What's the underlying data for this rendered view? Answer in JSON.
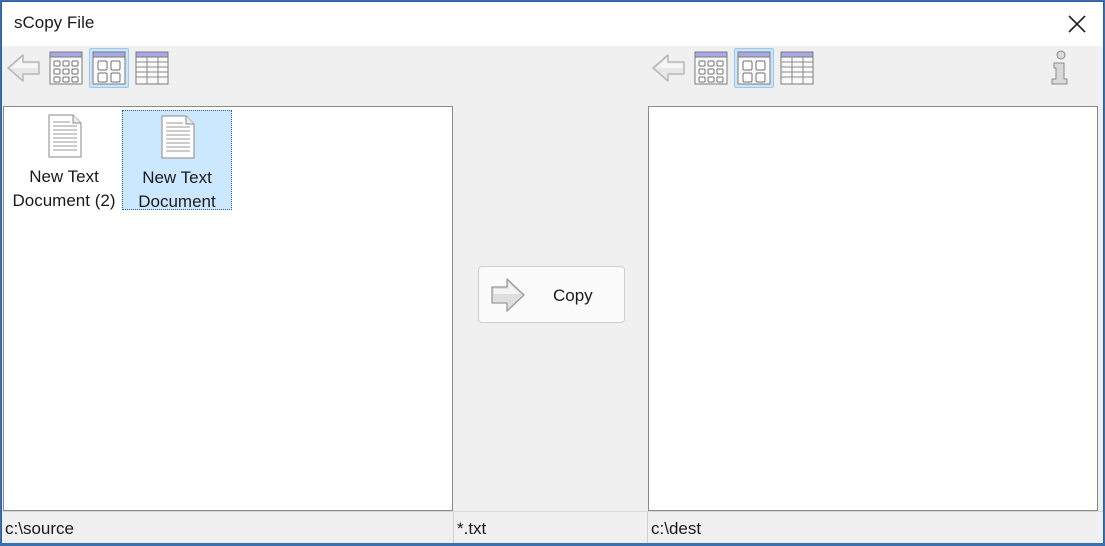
{
  "window": {
    "title": "sCopy File"
  },
  "source_pane": {
    "files": [
      {
        "name": "New Text Document (2)",
        "line1": "New Text",
        "line2": "Document (2)",
        "selected": false
      },
      {
        "name": "New Text Document",
        "line1": "New Text",
        "line2": "Document",
        "selected": true
      }
    ]
  },
  "dest_pane": {
    "files": []
  },
  "copy_button": {
    "label": "Copy"
  },
  "status": {
    "source_path": "c:\\source",
    "filter": "*.txt",
    "dest_path": "c:\\dest"
  },
  "toolbars": {
    "left": {
      "buttons": [
        "back-icon",
        "small-icons-view-icon",
        "large-icons-view-icon",
        "details-view-icon"
      ],
      "active_view": "large-icons"
    },
    "right": {
      "buttons": [
        "back-icon",
        "small-icons-view-icon",
        "large-icons-view-icon",
        "details-view-icon"
      ],
      "active_view": "large-icons"
    },
    "info": "info-icon"
  },
  "colors": {
    "selection": "#cce8ff",
    "active_button": "#cce4f7",
    "window_border": "#2b5f9e"
  }
}
